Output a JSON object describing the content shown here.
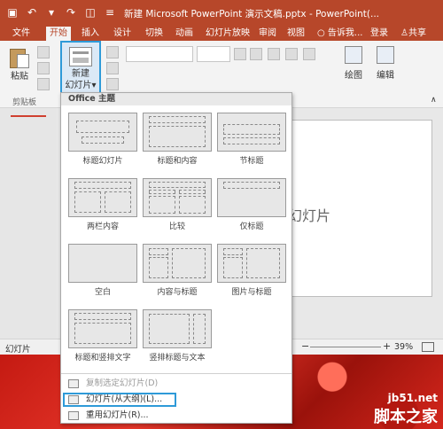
{
  "window": {
    "title": "新建 Microsoft PowerPoint 演示文稿.pptx - PowerPoint(..."
  },
  "quick_access": {
    "save_icon": "save-icon",
    "undo_icon": "undo-icon",
    "redo_icon": "redo-icon"
  },
  "tabs": [
    {
      "label": "文件"
    },
    {
      "label": "开始"
    },
    {
      "label": "插入"
    },
    {
      "label": "设计"
    },
    {
      "label": "切换"
    },
    {
      "label": "动画"
    },
    {
      "label": "幻灯片放映"
    },
    {
      "label": "审阅"
    },
    {
      "label": "视图"
    },
    {
      "label": "告诉我..."
    },
    {
      "label": "登录"
    },
    {
      "label": "共享"
    }
  ],
  "ribbon": {
    "paste_label": "粘贴",
    "clipboard_group": "剪贴板",
    "new_slide_label_1": "新建",
    "new_slide_label_2": "幻灯片",
    "drawing_label": "绘图",
    "editing_label": "编辑"
  },
  "gallery": {
    "header": "Office 主题",
    "layouts": [
      {
        "label": "标题幻灯片"
      },
      {
        "label": "标题和内容"
      },
      {
        "label": "节标题"
      },
      {
        "label": "两栏内容"
      },
      {
        "label": "比较"
      },
      {
        "label": "仅标题"
      },
      {
        "label": "空白"
      },
      {
        "label": "内容与标题"
      },
      {
        "label": "图片与标题"
      },
      {
        "label": "标题和竖排文字"
      },
      {
        "label": "竖排标题与文本"
      }
    ],
    "menu": {
      "duplicate": "复制选定幻灯片(D)",
      "from_outline": "幻灯片(从大纲)(L)...",
      "reuse": "重用幻灯片(R)..."
    }
  },
  "slide": {
    "text": "幻灯片"
  },
  "status": {
    "slide_label": "幻灯片",
    "zoom": "39%"
  },
  "watermark": {
    "line1": "jb51.net",
    "line2": "脚本之家"
  },
  "colors": {
    "accent": "#b7472a",
    "highlight": "#2e9ad8"
  }
}
